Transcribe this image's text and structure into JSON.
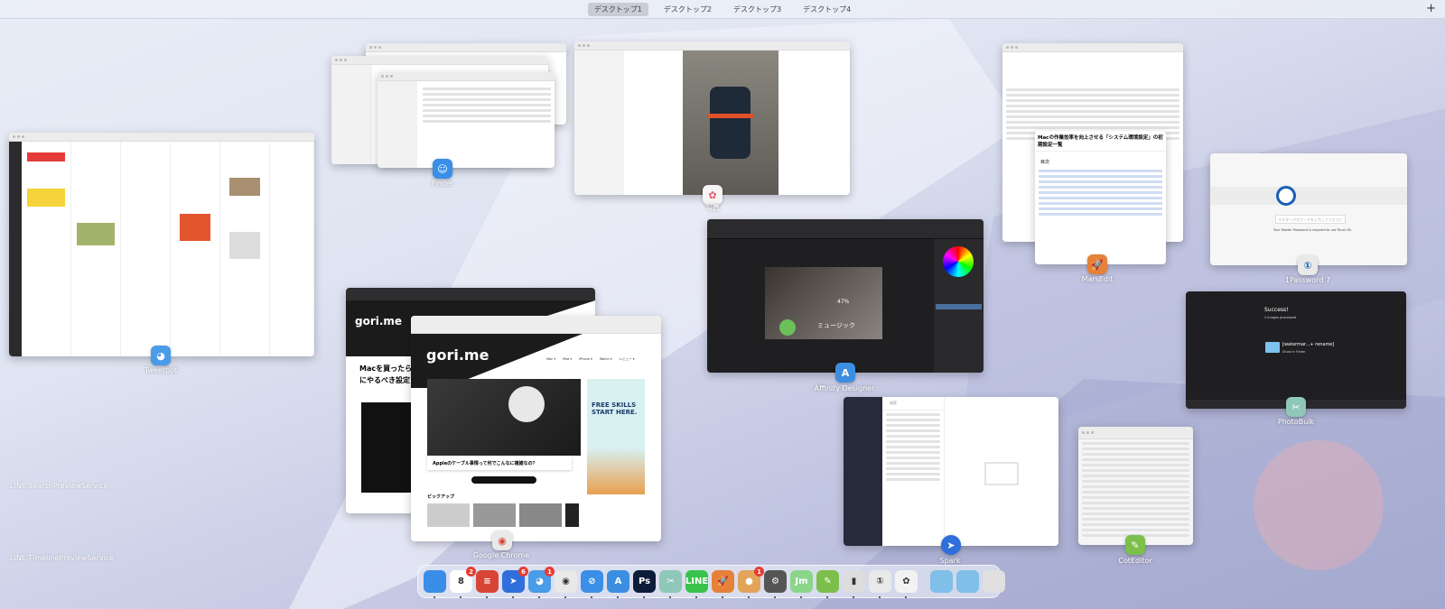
{
  "spaces": {
    "items": [
      "デスクトップ1",
      "デスクトップ2",
      "デスクトップ3",
      "デスクトップ4"
    ],
    "active": 0,
    "add_label": "+"
  },
  "windows": {
    "tweetbot": {
      "app": "Tweetbot"
    },
    "finder": {
      "app": "Finder"
    },
    "photos": {
      "app": "写真"
    },
    "affinity": {
      "app": "Affinity Designer",
      "canvas_text": "ミュージック",
      "battery": "47%"
    },
    "marsedit": {
      "app": "MarsEdit",
      "heading": "Macの作業効率を向上させる「システム環境設定」の初期設定一覧",
      "toc_title": "目次"
    },
    "onepassword": {
      "app": "1Password 7",
      "placeholder": "マスターパスワードを入力してください",
      "hint": "Your Master Password is required to use Touch ID."
    },
    "photobulk": {
      "app": "PhotoBulk",
      "title": "Success!",
      "sub": "2 images processed",
      "folder": "[watermar...+ rename]",
      "show": "Show in Finder"
    },
    "chrome": {
      "app": "Google Chrome",
      "site": "gori.me",
      "back_title": "Macを買ったら最初にやるべき設定まとめ",
      "article": "Appleのケーブル事情って何でこんなに複雑なの？",
      "ad": "FREE SKILLS START HERE.",
      "section": "ピックアップ",
      "nav": [
        "Mac ▾",
        "iPad ▾",
        "iPhone ▾",
        "Watch ▾",
        "レビュー ▾"
      ]
    },
    "spark": {
      "app": "Spark",
      "search": "検索"
    },
    "coteditor": {
      "app": "CotEditor"
    }
  },
  "hidden_apps": [
    "LINE SearchPreviewService",
    "LINE TimelinePreviewService"
  ],
  "dock": [
    {
      "name": "finder",
      "label": "",
      "color": "#3a8ee8"
    },
    {
      "name": "calendar",
      "label": "8",
      "color": "#ffffff",
      "badge": "2"
    },
    {
      "name": "todoist",
      "label": "≡",
      "color": "#d94535"
    },
    {
      "name": "spark",
      "label": "➤",
      "color": "#2f6fdc",
      "badge": "6"
    },
    {
      "name": "tweetbot",
      "label": "◕",
      "color": "#4a9be8",
      "badge": "1"
    },
    {
      "name": "chrome",
      "label": "◉",
      "color": "#e9e9e9"
    },
    {
      "name": "safari",
      "label": "⊘",
      "color": "#3b8fe6"
    },
    {
      "name": "affinity-designer",
      "label": "A",
      "color": "#3c8fe0"
    },
    {
      "name": "photoshop",
      "label": "Ps",
      "color": "#0c1d3a"
    },
    {
      "name": "photobulk",
      "label": "✂",
      "color": "#8fc7b8"
    },
    {
      "name": "line",
      "label": "LINE",
      "color": "#3ac34c"
    },
    {
      "name": "marsedit",
      "label": "🚀",
      "color": "#e6813a"
    },
    {
      "name": "cookie",
      "label": "●",
      "color": "#e3a45a",
      "badge": "1"
    },
    {
      "name": "system-preferences",
      "label": "⚙",
      "color": "#555"
    },
    {
      "name": "jump-desktop",
      "label": "Jm",
      "color": "#8bd58a"
    },
    {
      "name": "coteditor",
      "label": "✎",
      "color": "#7cbf4b"
    },
    {
      "name": "istat",
      "label": "▮",
      "color": "#ddd"
    },
    {
      "name": "1password",
      "label": "①",
      "color": "#e9e9e9"
    },
    {
      "name": "photos",
      "label": "✿",
      "color": "#f2f2f2"
    }
  ],
  "dock_right": [
    {
      "name": "documents-folder",
      "color": "#7fbfe8"
    },
    {
      "name": "downloads-folder",
      "color": "#7fbfe8"
    },
    {
      "name": "trash",
      "color": "#e0e0e0"
    }
  ]
}
